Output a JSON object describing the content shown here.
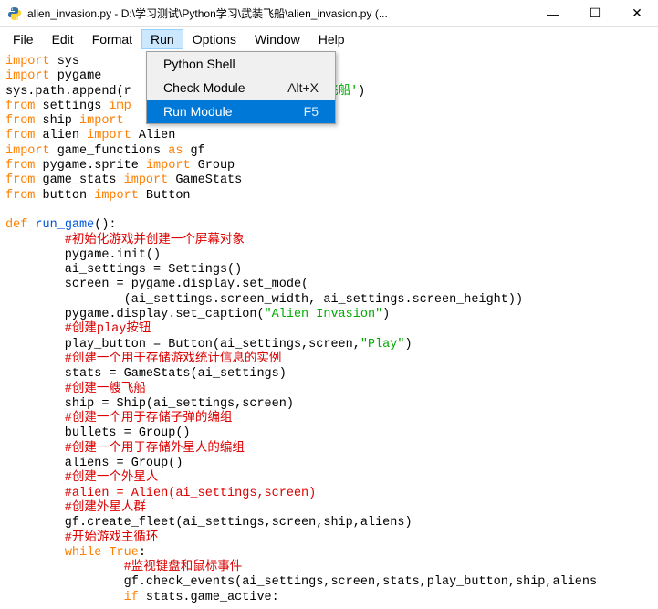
{
  "titlebar": {
    "title": "alien_invasion.py - D:\\学习测试\\Python学习\\武装飞船\\alien_invasion.py (..."
  },
  "win_controls": {
    "minimize": "—",
    "maximize": "☐",
    "close": "✕"
  },
  "menubar": {
    "file": "File",
    "edit": "Edit",
    "format": "Format",
    "run": "Run",
    "options": "Options",
    "window": "Window",
    "help": "Help"
  },
  "run_menu": {
    "items": [
      {
        "label": "Python Shell",
        "shortcut": ""
      },
      {
        "label": "Check Module",
        "shortcut": "Alt+X"
      },
      {
        "label": "Run Module",
        "shortcut": "F5"
      }
    ]
  },
  "code": {
    "l01a": "import",
    "l01b": " sys",
    "l02a": "import",
    "l02b": " pygame",
    "l03a": "sys.path.append(r",
    "l03str": "                       武装飞船'",
    "l03b": ")",
    "l04a": "from",
    "l04b": " settings ",
    "l04c": "imp",
    "l05a": "from",
    "l05b": " ship ",
    "l05c": "import",
    "l06a": "from",
    "l06b": " alien ",
    "l06c": "import",
    "l06d": " Alien",
    "l07a": "import",
    "l07b": " game_functions ",
    "l07c": "as",
    "l07d": " gf",
    "l08a": "from",
    "l08b": " pygame.sprite ",
    "l08c": "import",
    "l08d": " Group",
    "l09a": "from",
    "l09b": " game_stats ",
    "l09c": "import",
    "l09d": " GameStats",
    "l10a": "from",
    "l10b": " button ",
    "l10c": "import",
    "l10d": " Button",
    "l11": "",
    "l12a": "def",
    "l12b": " ",
    "l12c": "run_game",
    "l12d": "():",
    "l13": "        #初始化游戏并创建一个屏幕对象",
    "l14": "        pygame.init()",
    "l15": "        ai_settings = Settings()",
    "l16": "        screen = pygame.display.set_mode(",
    "l17": "                (ai_settings.screen_width, ai_settings.screen_height))",
    "l18a": "        pygame.display.set_caption(",
    "l18b": "\"Alien Invasion\"",
    "l18c": ")",
    "l19": "        #创建play按钮",
    "l20a": "        play_button = Button(ai_settings,screen,",
    "l20b": "\"Play\"",
    "l20c": ")",
    "l21": "        #创建一个用于存储游戏统计信息的实例",
    "l22": "        stats = GameStats(ai_settings)",
    "l23": "        #创建一艘飞船",
    "l24": "        ship = Ship(ai_settings,screen)",
    "l25": "        #创建一个用于存储子弹的编组",
    "l26": "        bullets = Group()",
    "l27": "        #创建一个用于存储外星人的编组",
    "l28": "        aliens = Group()",
    "l29": "        #创建一个外星人",
    "l30": "        #alien = Alien(ai_settings,screen)",
    "l31": "        #创建外星人群",
    "l32": "        gf.create_fleet(ai_settings,screen,ship,aliens)",
    "l33": "        #开始游戏主循环",
    "l34a": "        ",
    "l34b": "while",
    "l34c": " ",
    "l34d": "True",
    "l34e": ":",
    "l35": "                #监视键盘和鼠标事件",
    "l36": "                gf.check_events(ai_settings,screen,stats,play_button,ship,aliens",
    "l37a": "                ",
    "l37b": "if",
    "l37c": " stats.game_active:"
  }
}
